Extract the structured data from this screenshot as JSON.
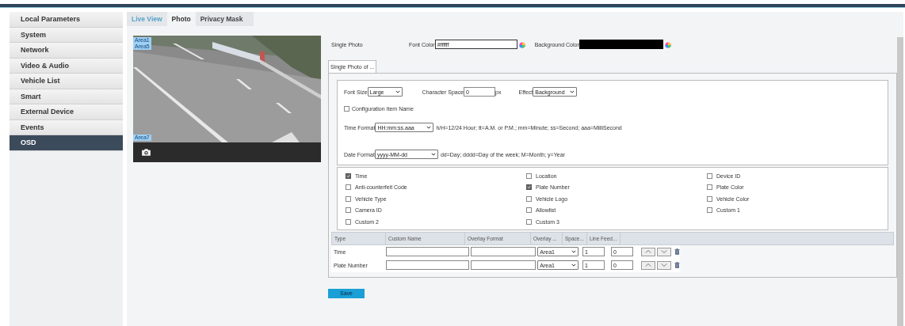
{
  "sidebar": {
    "items": [
      {
        "label": "Local Parameters",
        "selected": false
      },
      {
        "label": "System",
        "selected": false
      },
      {
        "label": "Network",
        "selected": false
      },
      {
        "label": "Video & Audio",
        "selected": false
      },
      {
        "label": "Vehicle List",
        "selected": false
      },
      {
        "label": "Smart",
        "selected": false
      },
      {
        "label": "External Device",
        "selected": false
      },
      {
        "label": "Events",
        "selected": false
      },
      {
        "label": "OSD",
        "selected": true
      }
    ]
  },
  "tabs": [
    {
      "label": "Live View",
      "selected": false
    },
    {
      "label": "Photo",
      "selected": true
    },
    {
      "label": "Privacy Mask",
      "selected": false
    }
  ],
  "video": {
    "top_area_labels": [
      "Area1",
      "Area5"
    ],
    "bottom_area_labels": [
      "Area7"
    ]
  },
  "single_photo": {
    "label": "Single Photo",
    "font_color": {
      "label": "Font Color",
      "value": "#ffffff"
    },
    "background_color": {
      "label": "Background Color"
    }
  },
  "sub_tab": {
    "label": "Single Photo of ...",
    "selected": true
  },
  "settings": {
    "font_size": {
      "label": "Font Size",
      "value": "Large"
    },
    "character_space": {
      "label": "Character Space",
      "value": "0",
      "unit": "px"
    },
    "effect": {
      "label": "Effect",
      "value": "Background"
    },
    "config_item_name": {
      "label": "Configuration Item Name",
      "checked": false
    },
    "time_format": {
      "label": "Time Format",
      "value": "HH:mm:ss.aaa",
      "hint": "h/H=12/24 Hour; tt=A.M. or P.M.; mm=Minute; ss=Second; aaa=MilliSecond"
    },
    "date_format": {
      "label": "Date Format",
      "value": "yyyy-MM-dd",
      "hint": "dd=Day; dddd=Day of the week; M=Month; y=Year"
    }
  },
  "items": [
    {
      "label": "Time",
      "checked": true
    },
    {
      "label": "Location",
      "checked": false
    },
    {
      "label": "Device ID",
      "checked": false
    },
    {
      "label": "Anti-counterfeit Code",
      "checked": false
    },
    {
      "label": "Plate Number",
      "checked": true
    },
    {
      "label": "Plate Color",
      "checked": false
    },
    {
      "label": "Vehicle Type",
      "checked": false
    },
    {
      "label": "Vehicle Logo",
      "checked": false
    },
    {
      "label": "Vehicle Color",
      "checked": false
    },
    {
      "label": "Camera ID",
      "checked": false
    },
    {
      "label": "Allowlist",
      "checked": false
    },
    {
      "label": "Custom 1",
      "checked": false
    },
    {
      "label": "Custom 2",
      "checked": false
    },
    {
      "label": "Custom 3",
      "checked": false
    }
  ],
  "table": {
    "columns": [
      "Type",
      "Custom Name",
      "Overlay Format",
      "Overlay ...",
      "Space...",
      "Line Feed..."
    ],
    "rows": [
      {
        "type": "Time",
        "area": "Area1",
        "space": "1",
        "line_feed": "0"
      },
      {
        "type": "Plate Number",
        "area": "Area1",
        "space": "1",
        "line_feed": "0"
      }
    ]
  },
  "save_button": "Save"
}
